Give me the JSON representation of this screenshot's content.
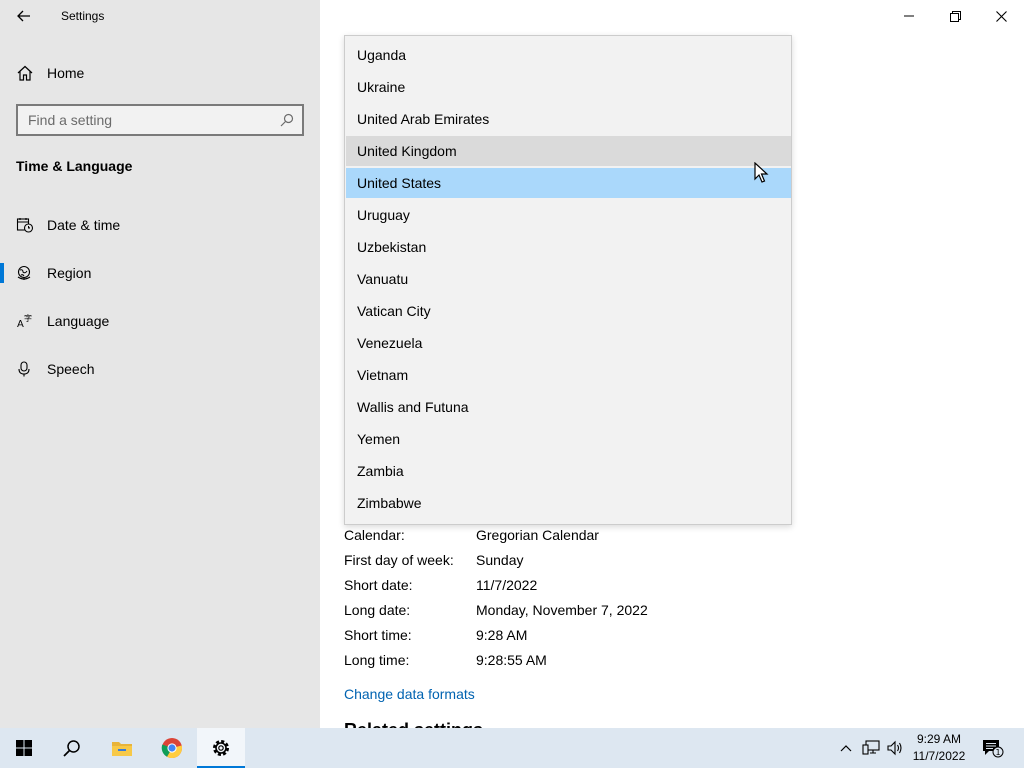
{
  "window": {
    "title": "Settings",
    "controls": {
      "minimize": "minimize",
      "maximize": "restore",
      "close": "close"
    }
  },
  "sidebar": {
    "home_label": "Home",
    "search_placeholder": "Find a setting",
    "section_title": "Time & Language",
    "items": [
      {
        "label": "Date & time",
        "icon": "date-time-icon",
        "active": false
      },
      {
        "label": "Region",
        "icon": "region-globe-icon",
        "active": true
      },
      {
        "label": "Language",
        "icon": "language-icon",
        "active": false
      },
      {
        "label": "Speech",
        "icon": "microphone-icon",
        "active": false
      }
    ]
  },
  "country_list": {
    "options": [
      "Uganda",
      "Ukraine",
      "United Arab Emirates",
      "United Kingdom",
      "United States",
      "Uruguay",
      "Uzbekistan",
      "Vanuatu",
      "Vatican City",
      "Venezuela",
      "Vietnam",
      "Wallis and Futuna",
      "Yemen",
      "Zambia",
      "Zimbabwe"
    ],
    "hovered": "United Kingdom",
    "selected": "United States"
  },
  "regional_format": {
    "rows": [
      {
        "key": "Calendar:",
        "value": "Gregorian Calendar"
      },
      {
        "key": "First day of week:",
        "value": "Sunday"
      },
      {
        "key": "Short date:",
        "value": "11/7/2022"
      },
      {
        "key": "Long date:",
        "value": "Monday, November 7, 2022"
      },
      {
        "key": "Short time:",
        "value": "9:28 AM"
      },
      {
        "key": "Long time:",
        "value": "9:28:55 AM"
      }
    ],
    "change_link": "Change data formats"
  },
  "related_settings_title": "Related settings",
  "taskbar": {
    "apps": [
      "start-icon",
      "search-icon",
      "file-explorer-icon",
      "chrome-icon",
      "settings-gear-icon"
    ],
    "active_app": "settings-gear-icon",
    "clock_time": "9:29 AM",
    "clock_date": "11/7/2022",
    "notification_count": "1"
  },
  "colors": {
    "accent": "#0078d7",
    "selected_bg": "#aad8fb",
    "hover_bg": "#dadada",
    "link": "#0063b1",
    "sidebar_bg": "#e6e6e6",
    "taskbar_bg": "#dde7f1"
  }
}
